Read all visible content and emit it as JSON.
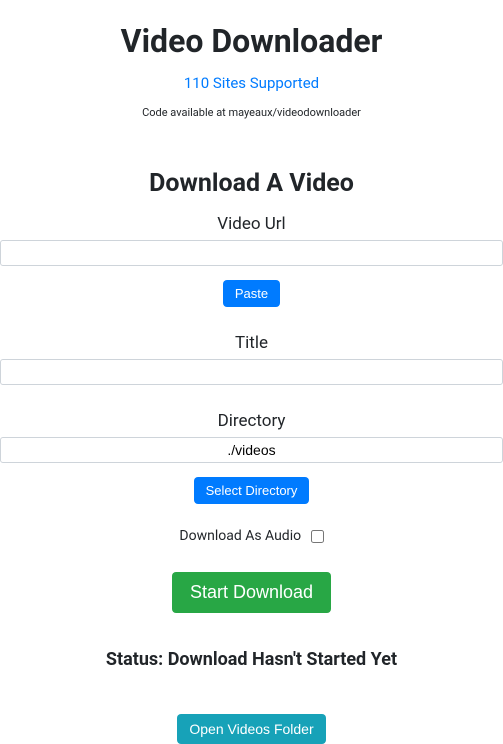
{
  "header": {
    "title": "Video Downloader",
    "sites_link": "110 Sites Supported",
    "code_note": "Code available at mayeaux/videodownloader"
  },
  "form": {
    "heading": "Download A Video",
    "video_url": {
      "label": "Video Url",
      "value": "",
      "paste_button": "Paste"
    },
    "title": {
      "label": "Title",
      "value": ""
    },
    "directory": {
      "label": "Directory",
      "value": "./videos",
      "select_button": "Select Directory"
    },
    "audio_checkbox": {
      "label": "Download As Audio",
      "checked": false
    },
    "start_button": "Start Download"
  },
  "status": {
    "prefix": "Status: ",
    "message": "Download Hasn't Started Yet"
  },
  "footer": {
    "open_folder_button": "Open Videos Folder"
  }
}
